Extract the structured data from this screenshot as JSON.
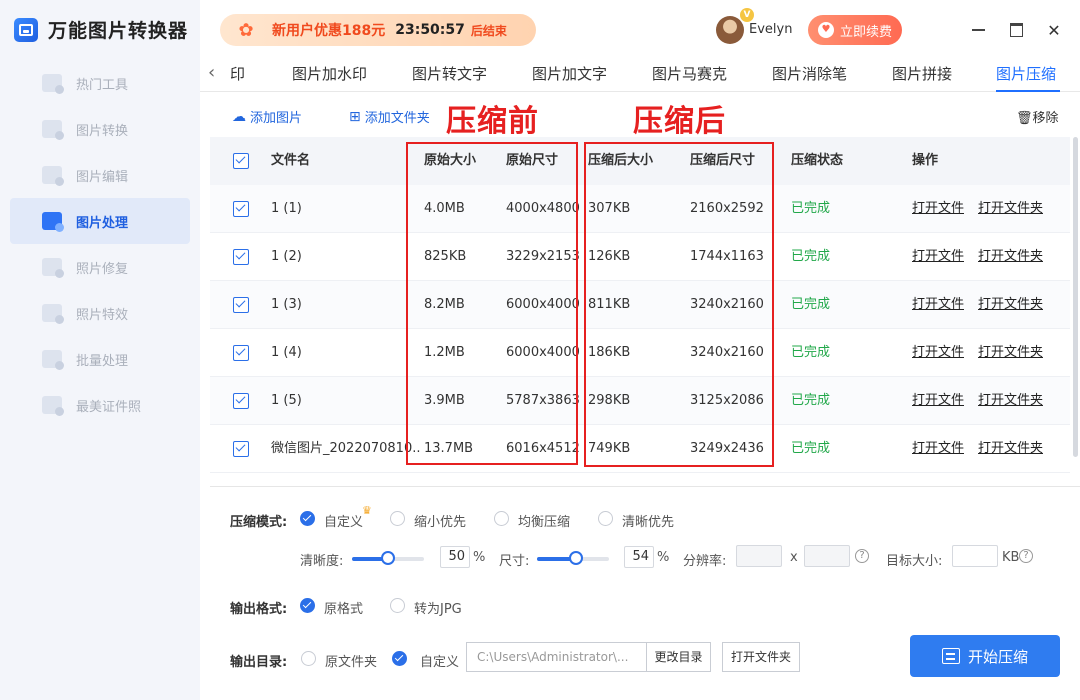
{
  "app": {
    "title": "万能图片转换器"
  },
  "sidebar": {
    "items": [
      {
        "label": "热门工具",
        "icon": "hot-tools-icon"
      },
      {
        "label": "图片转换",
        "icon": "image-convert-icon"
      },
      {
        "label": "图片编辑",
        "icon": "image-edit-icon"
      },
      {
        "label": "图片处理",
        "icon": "image-process-icon",
        "active": true
      },
      {
        "label": "照片修复",
        "icon": "photo-repair-icon"
      },
      {
        "label": "照片特效",
        "icon": "photo-effects-icon"
      },
      {
        "label": "批量处理",
        "icon": "batch-process-icon"
      },
      {
        "label": "最美证件照",
        "icon": "id-photo-icon"
      }
    ]
  },
  "topbar": {
    "promo_text": "新用户优惠188元",
    "promo_timer": "23:50:57",
    "promo_end": "后结束",
    "vip_badge": "V",
    "username": "Evelyn",
    "renew_label": "立即续费"
  },
  "tabs": {
    "items": [
      "‹印",
      "图片加水印",
      "图片转文字",
      "图片加文字",
      "图片马赛克",
      "图片消除笔",
      "图片拼接",
      "图片压缩"
    ],
    "active": "图片压缩"
  },
  "toolbar": {
    "add_image": "添加图片",
    "add_folder": "添加文件夹",
    "remove": "移除"
  },
  "annotations": {
    "before": "压缩前",
    "after": "压缩后"
  },
  "table": {
    "headers": {
      "name": "文件名",
      "orig_size": "原始大小",
      "orig_dim": "原始尺寸",
      "new_size": "压缩后大小",
      "new_dim": "压缩后尺寸",
      "status": "压缩状态",
      "ops": "操作"
    },
    "rows": [
      {
        "name": "1 (1)",
        "orig_size": "4.0MB",
        "orig_dim": "4000x4800",
        "new_size": "307KB",
        "new_dim": "2160x2592",
        "status": "已完成",
        "op_open": "打开文件",
        "op_folder": "打开文件夹"
      },
      {
        "name": "1 (2)",
        "orig_size": "825KB",
        "orig_dim": "3229x2153",
        "new_size": "126KB",
        "new_dim": "1744x1163",
        "status": "已完成",
        "op_open": "打开文件",
        "op_folder": "打开文件夹"
      },
      {
        "name": "1 (3)",
        "orig_size": "8.2MB",
        "orig_dim": "6000x4000",
        "new_size": "811KB",
        "new_dim": "3240x2160",
        "status": "已完成",
        "op_open": "打开文件",
        "op_folder": "打开文件夹"
      },
      {
        "name": "1 (4)",
        "orig_size": "1.2MB",
        "orig_dim": "6000x4000",
        "new_size": "186KB",
        "new_dim": "3240x2160",
        "status": "已完成",
        "op_open": "打开文件",
        "op_folder": "打开文件夹"
      },
      {
        "name": "1 (5)",
        "orig_size": "3.9MB",
        "orig_dim": "5787x3863",
        "new_size": "298KB",
        "new_dim": "3125x2086",
        "status": "已完成",
        "op_open": "打开文件",
        "op_folder": "打开文件夹"
      },
      {
        "name": "微信图片_2022070810...",
        "orig_size": "13.7MB",
        "orig_dim": "6016x4512",
        "new_size": "749KB",
        "new_dim": "3249x2436",
        "status": "已完成",
        "op_open": "打开文件",
        "op_folder": "打开文件夹"
      }
    ]
  },
  "settings": {
    "mode_label": "压缩模式:",
    "modes": [
      "自定义",
      "缩小优先",
      "均衡压缩",
      "清晰优先"
    ],
    "mode_selected": "自定义",
    "clarity_label": "清晰度:",
    "clarity_value": "50",
    "clarity_fraction": 0.5,
    "percent": "%",
    "size_label": "尺寸:",
    "size_value": "54",
    "size_fraction": 0.54,
    "resolution_label": "分辨率:",
    "resolution_x": "x",
    "target_label": "目标大小:",
    "target_unit": "KB",
    "format_label": "输出格式:",
    "formats": [
      "原格式",
      "转为JPG"
    ],
    "format_selected": "原格式",
    "dir_label": "输出目录:",
    "dirs": [
      "原文件夹",
      "自定义"
    ],
    "dir_selected": "自定义",
    "dir_path": "C:\\Users\\Administrator\\...",
    "change_dir": "更改目录",
    "open_folder": "打开文件夹",
    "start_label": "开始压缩"
  }
}
